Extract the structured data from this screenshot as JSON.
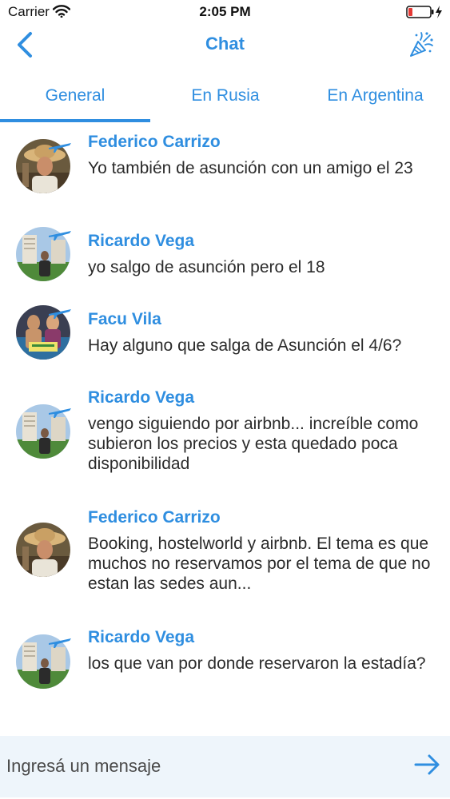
{
  "status_bar": {
    "carrier": "Carrier",
    "time": "2:05 PM"
  },
  "nav": {
    "title": "Chat",
    "back_icon": "chevron-left-icon",
    "action_icon": "party-popper-icon"
  },
  "tabs": [
    {
      "label": "General",
      "selected": true
    },
    {
      "label": "En Rusia",
      "selected": false
    },
    {
      "label": "En Argentina",
      "selected": false
    }
  ],
  "messages": [
    {
      "sender": "Federico Carrizo",
      "text": "Yo también de asunción con un amigo el 23",
      "avatar": "federico"
    },
    {
      "sender": "Ricardo Vega",
      "text": "yo salgo de asunción pero el 18",
      "avatar": "ricardo"
    },
    {
      "sender": "Facu Vila",
      "text": "Hay alguno que salga de Asunción el 4/6?",
      "avatar": "facu"
    },
    {
      "sender": "Ricardo Vega",
      "text": "vengo siguiendo por airbnb... increíble como subieron los precios y esta quedado poca disponibilidad",
      "avatar": "ricardo"
    },
    {
      "sender": "Federico Carrizo",
      "text": "Booking, hostelworld y airbnb. El tema es que muchos no reservamos por el tema de que no estan las sedes aun...",
      "avatar": "federico"
    },
    {
      "sender": "Ricardo Vega",
      "text": "los que van por donde reservaron la estadía?",
      "avatar": "ricardo"
    }
  ],
  "composer": {
    "placeholder": "Ingresá un mensaje",
    "send_icon": "arrow-right-icon"
  },
  "colors": {
    "accent": "#2f8ee0",
    "text": "#2b2b2b",
    "composer_bg": "#eef5fb",
    "battery_low": "#e53935"
  }
}
